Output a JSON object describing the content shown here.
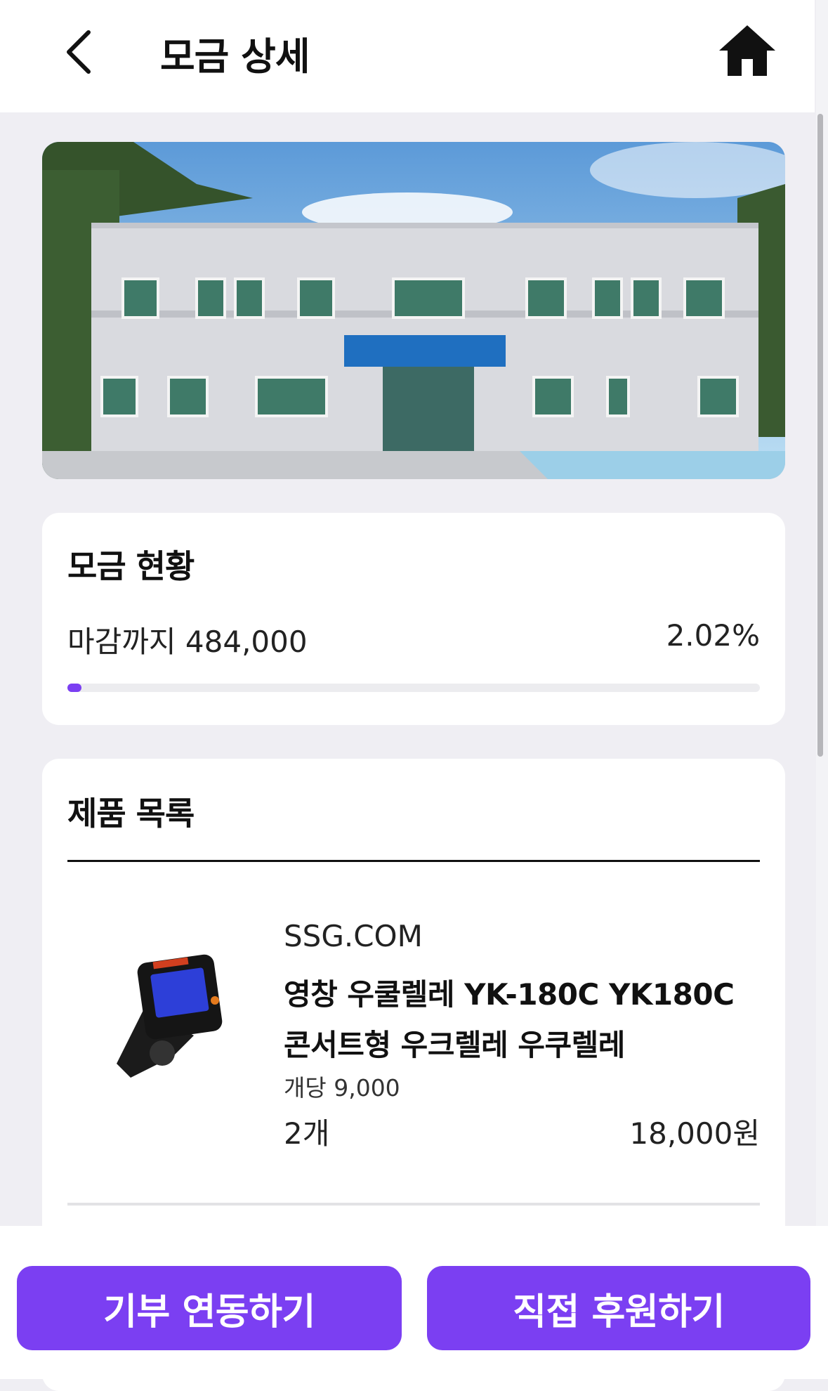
{
  "header": {
    "title": "모금 상세",
    "back_icon": "chevron-left-icon",
    "home_icon": "home-icon"
  },
  "status": {
    "title": "모금 현황",
    "remaining_label": "마감까지 484,000",
    "percent_label": "2.02%",
    "progress": 0.0202,
    "accent_color": "#7b3ff2"
  },
  "products": {
    "title": "제품 목록",
    "items": [
      {
        "shop": "SSG.COM",
        "name": "영창 우쿨렐레 YK-180C YK180C 콘서트형 우크렐레 우쿠렐레",
        "unit_price": "개당 9,000",
        "quantity": "2개",
        "total": "18,000원"
      }
    ]
  },
  "actions": {
    "donate_label": "기부 연동하기",
    "support_label": "직접 후원하기"
  }
}
